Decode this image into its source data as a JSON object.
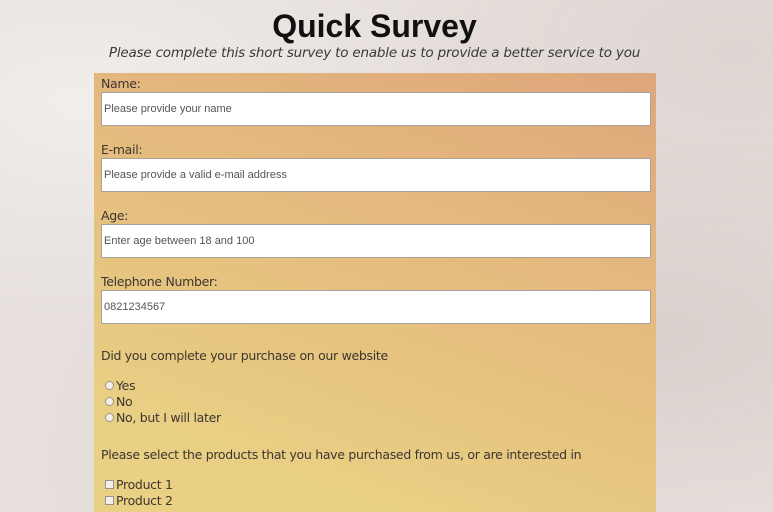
{
  "header": {
    "title": "Quick Survey",
    "subtitle": "Please complete this short survey to enable us to provide a better service to you"
  },
  "form": {
    "name": {
      "label": "Name:",
      "placeholder": "Please provide your name"
    },
    "email": {
      "label": "E-mail:",
      "placeholder": "Please provide a valid e-mail address"
    },
    "age": {
      "label": "Age:",
      "placeholder": "Enter age between 18 and 100"
    },
    "telephone": {
      "label": "Telephone Number:",
      "placeholder": "0821234567"
    },
    "purchase_question": "Did you complete your purchase on our website",
    "purchase_options": [
      "Yes",
      "No",
      "No, but I will later"
    ],
    "products_question": "Please select the products that you have purchased from us, or are interested in",
    "products": [
      "Product 1",
      "Product 2"
    ]
  },
  "colors": {
    "page_background": "#e6dfdb",
    "panel_top": "#dea67c",
    "panel_bottom": "#ead184"
  }
}
